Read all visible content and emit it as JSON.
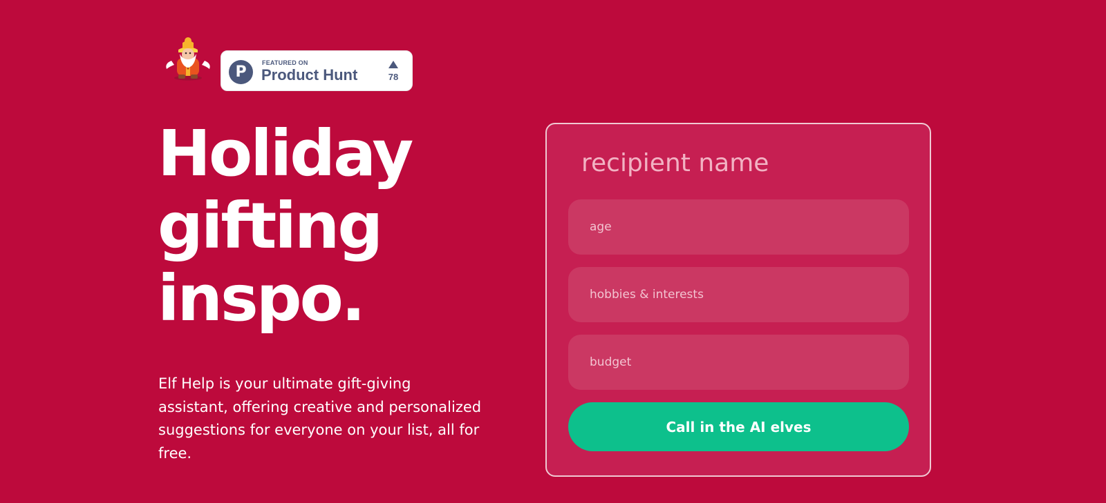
{
  "header": {
    "badge": {
      "featured_label": "FEATURED ON",
      "product_label": "Product Hunt",
      "logo_letter": "P",
      "upvote_count": "78"
    }
  },
  "hero": {
    "headline_lines": [
      "Holiday",
      "gifting",
      "inspo."
    ],
    "description": "Elf Help is your ultimate gift-giving assistant, offering creative and personalized suggestions for everyone on your list, all for free."
  },
  "form": {
    "recipient_placeholder": "recipient name",
    "age_placeholder": "age",
    "hobbies_placeholder": "hobbies & interests",
    "budget_placeholder": "budget",
    "submit_label": "Call in the AI elves"
  },
  "colors": {
    "background": "#bd0a3c",
    "card": "#c61f52",
    "field": "#cb3863",
    "button": "#0dc08c",
    "product_hunt": "#4b587c"
  },
  "icons": {
    "logo": "santa-elf-logo-icon",
    "badge_logo": "product-hunt-logo-icon",
    "upvote": "upvote-triangle-icon"
  }
}
